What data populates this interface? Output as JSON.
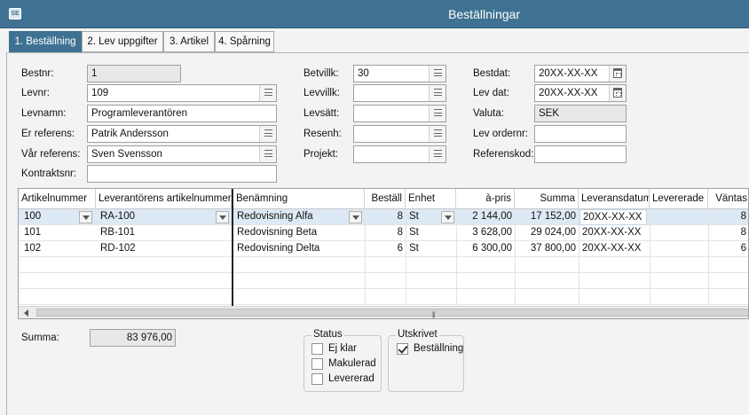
{
  "window": {
    "title": "Beställningar",
    "icon": "app-logo-icon"
  },
  "tabs": [
    {
      "label": "1. Beställning",
      "active": true
    },
    {
      "label": "2. Lev uppgifter",
      "active": false
    },
    {
      "label": "3. Artikel",
      "active": false
    },
    {
      "label": "4. Spårning",
      "active": false
    }
  ],
  "form": {
    "bestnr": {
      "label": "Bestnr:",
      "value": "1"
    },
    "levnr": {
      "label": "Levnr:",
      "value": "109"
    },
    "levnamn": {
      "label": "Levnamn:",
      "value": "Programleverantören"
    },
    "er_referens": {
      "label": "Er referens:",
      "value": "Patrik Andersson"
    },
    "var_referens": {
      "label": "Vår referens:",
      "value": "Sven Svensson"
    },
    "kontraktsnr": {
      "label": "Kontraktsnr:",
      "value": ""
    },
    "betvillk": {
      "label": "Betvillk:",
      "value": "30"
    },
    "levvillk": {
      "label": "Levvillk:",
      "value": ""
    },
    "levsatt": {
      "label": "Levsätt:",
      "value": ""
    },
    "resenh": {
      "label": "Resenh:",
      "value": ""
    },
    "projekt": {
      "label": "Projekt:",
      "value": ""
    },
    "bestdat": {
      "label": "Bestdat:",
      "value": "20XX-XX-XX"
    },
    "lev_dat": {
      "label": "Lev dat:",
      "value": "20XX-XX-XX"
    },
    "valuta": {
      "label": "Valuta:",
      "value": "SEK"
    },
    "lev_ordernr": {
      "label": "Lev ordernr:",
      "value": ""
    },
    "referenskod": {
      "label": "Referenskod:",
      "value": ""
    }
  },
  "grid": {
    "headers": [
      "Artikelnummer",
      "Leverantörens artikelnummer",
      "Benämning",
      "Beställ",
      "Enhet",
      "à-pris",
      "Summa",
      "Leveransdatum",
      "Levererade",
      "Väntas"
    ],
    "rows": [
      {
        "artnr": "100",
        "levart": "RA-100",
        "ben": "Redovisning Alfa",
        "best": "8",
        "enh": "St",
        "pris": "2 144,00",
        "summa": "17 152,00",
        "levdat": "20XX-XX-XX",
        "levererade": "",
        "vantas": "8"
      },
      {
        "artnr": "101",
        "levart": "RB-101",
        "ben": "Redovisning Beta",
        "best": "8",
        "enh": "St",
        "pris": "3 628,00",
        "summa": "29 024,00",
        "levdat": "20XX-XX-XX",
        "levererade": "",
        "vantas": "8"
      },
      {
        "artnr": "102",
        "levart": "RD-102",
        "ben": "Redovisning Delta",
        "best": "6",
        "enh": "St",
        "pris": "6 300,00",
        "summa": "37 800,00",
        "levdat": "20XX-XX-XX",
        "levererade": "",
        "vantas": "6"
      }
    ]
  },
  "summary": {
    "label": "Summa:",
    "value": "83 976,00"
  },
  "status": {
    "caption": "Status",
    "items": [
      {
        "label": "Ej klar",
        "checked": false
      },
      {
        "label": "Makulerad",
        "checked": false
      },
      {
        "label": "Levererad",
        "checked": false
      }
    ]
  },
  "utskrivet": {
    "caption": "Utskrivet",
    "items": [
      {
        "label": "Beställning",
        "checked": true
      }
    ]
  }
}
